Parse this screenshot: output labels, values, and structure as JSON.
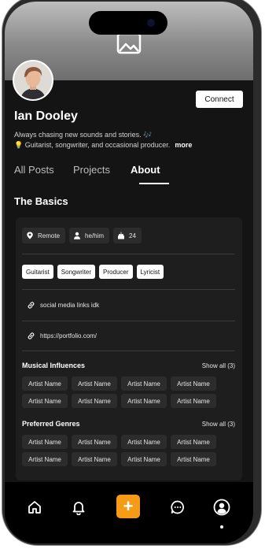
{
  "profile": {
    "name": "Ian Dooley",
    "bio_line1": "Always chasing new sounds and stories. 🎶",
    "bio_line2": "💡 Guitarist, songwriter, and occasional producer.",
    "more_label": "more",
    "connect_label": "Connect"
  },
  "tabs": [
    "All Posts",
    "Projects",
    "About"
  ],
  "active_tab": "About",
  "about": {
    "section_title": "The Basics",
    "info": [
      {
        "icon": "location-pin-icon",
        "label": "Remote"
      },
      {
        "icon": "person-icon",
        "label": "he/him"
      },
      {
        "icon": "birthday-cake-icon",
        "label": "24"
      }
    ],
    "roles": [
      "Guitarist",
      "Songwriter",
      "Producer",
      "Lyricist"
    ],
    "links": [
      {
        "icon": "link-icon",
        "label": "social media links idk"
      },
      {
        "icon": "link-icon",
        "label": "https://portfolio.com/"
      }
    ],
    "influences": {
      "title": "Musical Influences",
      "show_all": "Show all (3)",
      "items": [
        "Artist Name",
        "Artist Name",
        "Artist Name",
        "Artist Name",
        "Artist Name",
        "Artist Name",
        "Artist Name",
        "Artist Name"
      ]
    },
    "genres": {
      "title": "Preferred Genres",
      "show_all": "Show all (3)",
      "items": [
        "Artist Name",
        "Artist Name",
        "Artist Name",
        "Artist Name",
        "Artist Name",
        "Artist Name",
        "Artist Name",
        "Artist Name"
      ]
    }
  },
  "nav": {
    "items": [
      "home-icon",
      "bell-icon",
      "plus-icon",
      "chat-icon",
      "profile-icon"
    ],
    "plus_label": "+",
    "active": "profile-icon"
  },
  "colors": {
    "background": "#141414",
    "card": "#1e1e1e",
    "accent": "#f59b16"
  }
}
